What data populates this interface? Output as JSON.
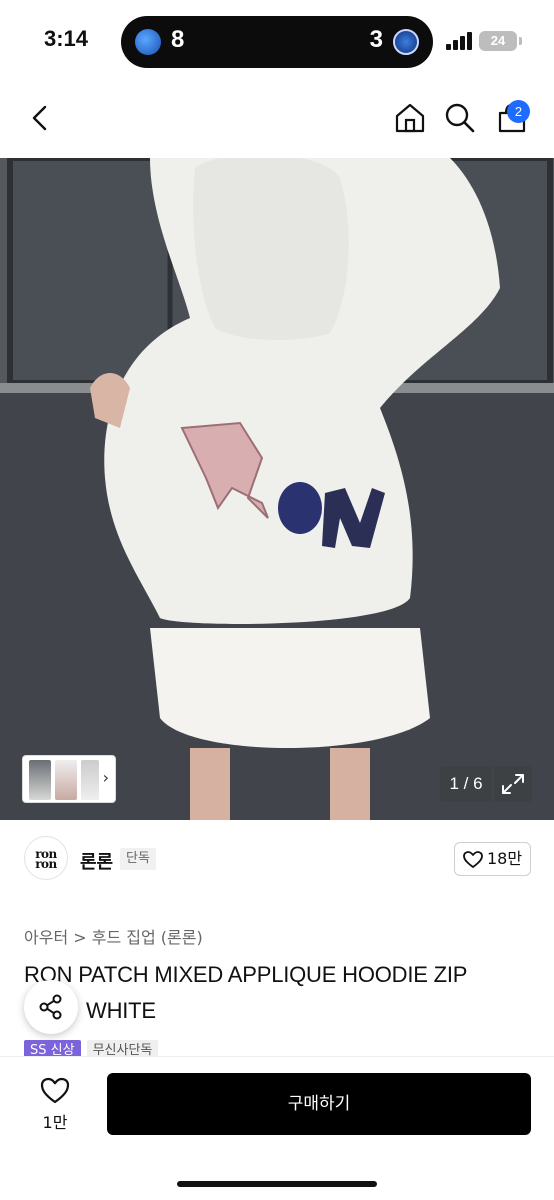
{
  "status_bar": {
    "time": "3:14",
    "score_left": "8",
    "score_right": "3",
    "battery": "24",
    "signal_icon": "cellular-signal-icon"
  },
  "nav": {
    "back_icon": "chevron-left-icon",
    "home_icon": "home-icon",
    "search_icon": "search-icon",
    "cart_icon": "shopping-bag-icon",
    "cart_count": "2",
    "badge_color": "#1e6bff"
  },
  "gallery": {
    "counter": "1 / 6",
    "current_page": 1,
    "total_pages": 6,
    "expand_icon": "expand-icon"
  },
  "brand": {
    "logo_text_top": "ron",
    "logo_text_bottom": "ron",
    "name": "론론",
    "tag": "단독",
    "likes": "18만"
  },
  "product": {
    "breadcrumb": "아우터 > 후드 집업 (론론)",
    "title_line1": "RON PATCH MIXED APPLIQUE HOODIE ZIP",
    "title_line2": "WHITE",
    "tags": [
      "SS 신상",
      "무신사단독"
    ],
    "tag_color": "#7b63d9"
  },
  "bottom_bar": {
    "wish_count": "1만",
    "buy_label": "구매하기"
  }
}
